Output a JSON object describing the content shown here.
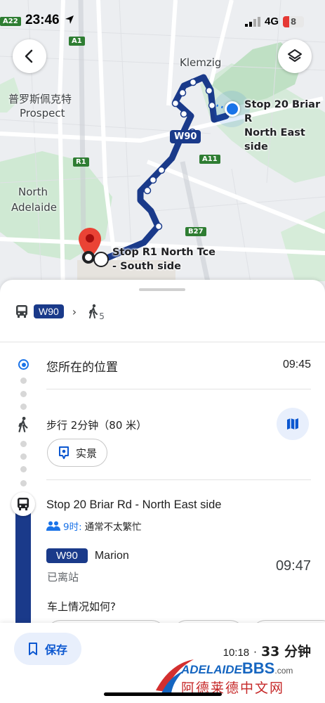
{
  "statusbar": {
    "time": "23:46",
    "network": "4G",
    "battery": "8"
  },
  "map": {
    "labels": {
      "klemzig": "Klemzig",
      "prospect_cn": "普罗斯佩克特",
      "prospect": "Prospect",
      "north_adelaide_1": "North",
      "north_adelaide_2": "Adelaide"
    },
    "road_shields": {
      "a22": "A22",
      "a1": "A1",
      "r1": "R1",
      "a11": "A11",
      "b27": "B27"
    },
    "route_chip": "W90",
    "stop_start": {
      "line1": "Stop 20 Briar R",
      "line2": "North East side"
    },
    "stop_end": {
      "line1": "Stop R1 North Tce",
      "line2": "- South side"
    }
  },
  "summary": {
    "route": "W90",
    "arrow": "›",
    "walk_minutes": "5"
  },
  "steps": {
    "origin": {
      "label": "您所在的位置",
      "time": "09:45"
    },
    "walk": {
      "label": "步行 2分钟（80 米）",
      "streetview": "实景"
    },
    "board": {
      "stop": "Stop 20 Briar Rd - North East side",
      "crowd_time": "9时:",
      "crowd_text": "通常不太繁忙",
      "route": "W90",
      "destination": "Marion",
      "departed": "已离站",
      "time": "09:47",
      "question": "车上情况如何?"
    }
  },
  "bottom": {
    "save": "保存",
    "arrive": "10:18",
    "dot": "·",
    "duration": "33 分钟"
  },
  "watermark": {
    "brand_a": "ADELAIDE",
    "brand_b": "BBS",
    "brand_c": ".com",
    "cn": "阿德莱德中文网"
  },
  "colors": {
    "route": "#1a3a8a",
    "accent": "#0b57d0",
    "pin": "#ea4335",
    "park": "#cfe9d3"
  }
}
